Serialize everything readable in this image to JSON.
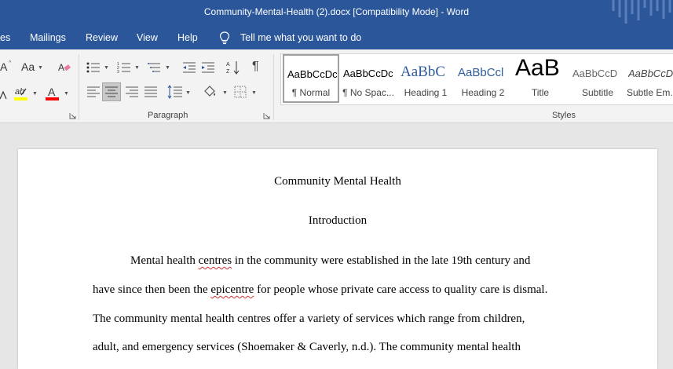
{
  "window": {
    "title": "Community-Mental-Health (2).docx [Compatibility Mode]  -  Word"
  },
  "menu": {
    "items": [
      "es",
      "Mailings",
      "Review",
      "View",
      "Help"
    ],
    "tell_me": "Tell me what you want to do"
  },
  "ribbon": {
    "font_group": {
      "case_label": "Aa",
      "partial_label": "A"
    },
    "paragraph_label": "Paragraph",
    "styles_label": "Styles",
    "styles": [
      {
        "preview": "AaBbCcDc",
        "label": "¶ Normal"
      },
      {
        "preview": "AaBbCcDc",
        "label": "¶ No Spac..."
      },
      {
        "preview": "AaBbC",
        "label": "Heading 1"
      },
      {
        "preview": "AaBbCcl",
        "label": "Heading 2"
      },
      {
        "preview": "AaB",
        "label": "Title"
      },
      {
        "preview": "AaBbCcD",
        "label": "Subtitle"
      },
      {
        "preview": "AaBbCcDc",
        "label": "Subtle Em..."
      }
    ],
    "colors": {
      "highlight": "#ffff00",
      "font_color": "#ff0000",
      "accent": "#2b579a"
    }
  },
  "document": {
    "title": "Community Mental Health",
    "heading": "Introduction",
    "lines": [
      {
        "pre": "Mental health ",
        "err": "centres",
        "post": " in the community were established in the late 19th century and"
      },
      {
        "pre": "have since then been the ",
        "err": "epicentre",
        "post": " for people whose private care access to quality care is dismal."
      },
      {
        "pre": "The community mental health centres offer a variety of services which range from children,",
        "err": "",
        "post": ""
      },
      {
        "pre": "adult, and emergency services (Shoemaker & Caverly, n.d.). The community mental health",
        "err": "",
        "post": ""
      }
    ]
  }
}
